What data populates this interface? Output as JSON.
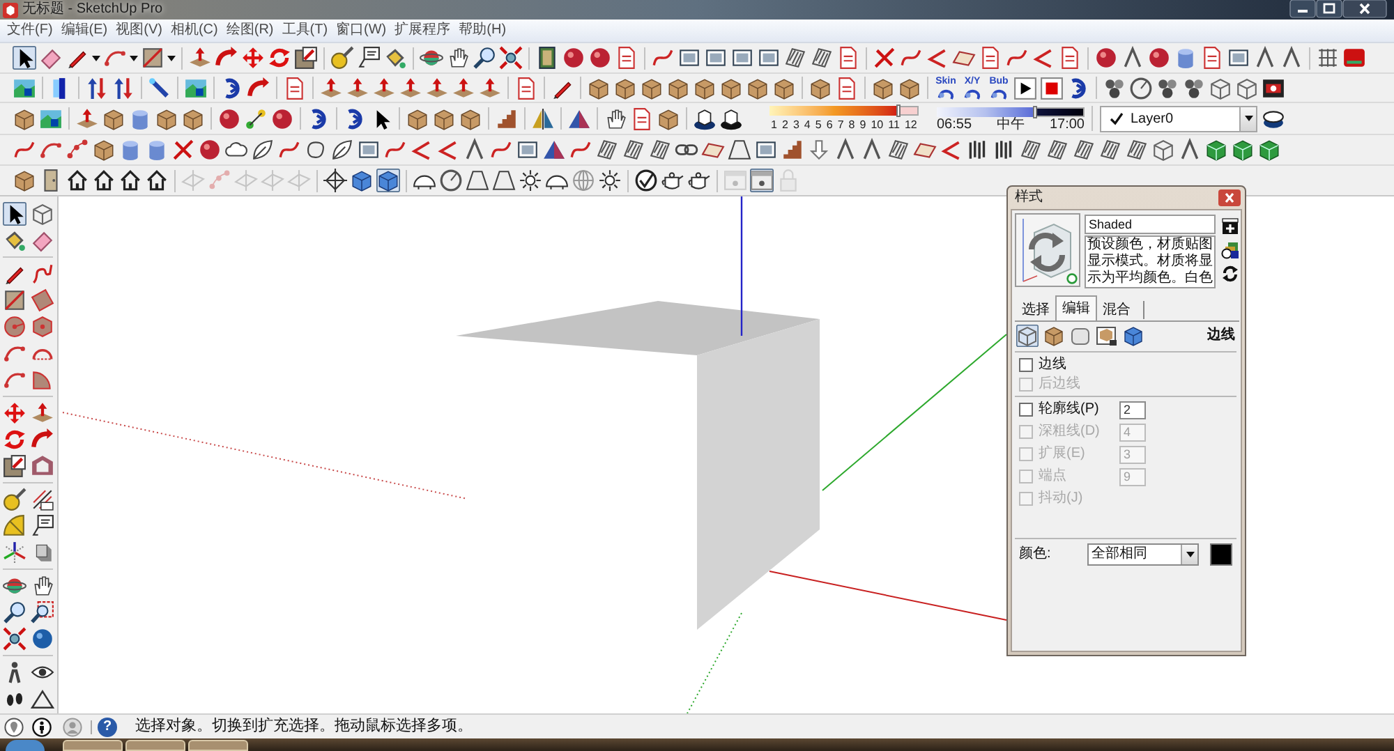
{
  "window": {
    "title": "无标题 - SketchUp Pro"
  },
  "menu": [
    "文件(F)",
    "编辑(E)",
    "视图(V)",
    "相机(C)",
    "绘图(R)",
    "工具(T)",
    "窗口(W)",
    "扩展程序",
    "帮助(H)"
  ],
  "toolbar_rows": [
    {
      "buttons": [
        {
          "selected": true
        },
        {
          "selected": false
        },
        {
          "selected": false
        },
        {
          "selected": false
        },
        {
          "selected": false
        },
        {
          "selected": false
        },
        {
          "selected": false
        },
        {
          "selected": false
        },
        {
          "selected": false
        },
        {
          "selected": false
        },
        {
          "selected": false
        },
        {
          "selected": false
        },
        {
          "selected": false
        },
        {
          "selected": false
        },
        {
          "selected": false
        },
        {
          "selected": false
        },
        {
          "selected": false
        },
        {
          "selected": false
        },
        {
          "selected": false
        },
        {
          "selected": false
        },
        {
          "selected": false
        },
        {
          "selected": false
        },
        {
          "selected": false
        },
        {
          "selected": false
        },
        {
          "selected": false
        },
        {
          "selected": false
        },
        {
          "selected": false
        },
        {
          "selected": false
        },
        {
          "selected": false
        },
        {
          "selected": false
        },
        {
          "selected": false
        },
        {
          "selected": false
        },
        {
          "selected": false
        },
        {
          "selected": false
        },
        {
          "selected": false
        },
        {
          "selected": false
        },
        {
          "selected": false
        },
        {
          "selected": false
        },
        {
          "selected": false
        },
        {
          "selected": false
        },
        {
          "selected": false
        },
        {
          "selected": false
        },
        {
          "selected": false
        },
        {
          "selected": false
        },
        {
          "selected": false
        },
        {
          "selected": false
        },
        {
          "selected": false
        }
      ]
    },
    {
      "buttons": [
        {
          "selected": false
        },
        {
          "selected": false
        },
        {
          "selected": false
        },
        {
          "selected": false
        },
        {
          "selected": false
        },
        {
          "selected": false
        },
        {
          "selected": false
        },
        {
          "selected": false
        },
        {
          "selected": false
        },
        {
          "selected": false
        },
        {
          "selected": false
        },
        {
          "selected": false
        },
        {
          "selected": false
        },
        {
          "selected": false
        },
        {
          "selected": false
        },
        {
          "selected": false
        },
        {
          "selected": false
        },
        {
          "selected": false
        },
        {
          "selected": false
        },
        {
          "selected": false
        },
        {
          "selected": false
        },
        {
          "selected": false
        },
        {
          "selected": false
        },
        {
          "selected": false
        },
        {
          "selected": false
        },
        {
          "selected": false
        },
        {
          "selected": false
        },
        {
          "selected": false
        },
        {
          "selected": false
        },
        {
          "selected": false
        },
        {
          "selected": false,
          "label": "Skin"
        },
        {
          "selected": false,
          "label": "X/Y"
        },
        {
          "selected": false,
          "label": "Bub"
        },
        {
          "selected": false
        },
        {
          "selected": false
        },
        {
          "selected": false
        },
        {
          "selected": false
        },
        {
          "selected": false
        },
        {
          "selected": false
        },
        {
          "selected": false
        },
        {
          "selected": false
        },
        {
          "selected": false
        },
        {
          "selected": false
        }
      ]
    },
    {
      "buttons": [
        {
          "selected": false
        },
        {
          "selected": false
        },
        {
          "selected": false
        },
        {
          "selected": false
        },
        {
          "selected": false
        },
        {
          "selected": false
        },
        {
          "selected": false
        },
        {
          "selected": false
        },
        {
          "selected": false
        },
        {
          "selected": false
        },
        {
          "selected": false
        },
        {
          "selected": false
        },
        {
          "selected": false
        },
        {
          "selected": false
        },
        {
          "selected": false
        },
        {
          "selected": false
        },
        {
          "selected": false
        },
        {
          "selected": false
        },
        {
          "selected": false
        },
        {
          "selected": false
        },
        {
          "selected": false
        },
        {
          "selected": false
        },
        {
          "selected": false
        },
        {
          "selected": false
        }
      ],
      "month_slider": {
        "level": 0.86,
        "ticks": [
          "1",
          "2",
          "3",
          "4",
          "5",
          "6",
          "7",
          "8",
          "9",
          "10",
          "11",
          "12"
        ]
      },
      "time_slider": {
        "level": 0.66,
        "labels": [
          "06:55",
          "中午",
          "17:00"
        ]
      },
      "layer": {
        "name": "Layer0",
        "checked": true
      },
      "layer_buttons": [
        {
          "selected": false
        }
      ]
    },
    {
      "buttons": [
        {
          "selected": false
        },
        {
          "selected": false
        },
        {
          "selected": false
        },
        {
          "selected": false
        },
        {
          "selected": false
        },
        {
          "selected": false
        },
        {
          "selected": false
        },
        {
          "selected": false
        },
        {
          "selected": false
        },
        {
          "selected": false
        },
        {
          "selected": false
        },
        {
          "selected": false
        },
        {
          "selected": false
        },
        {
          "selected": false
        },
        {
          "selected": false
        },
        {
          "selected": false
        },
        {
          "selected": false
        },
        {
          "selected": false
        },
        {
          "selected": false
        },
        {
          "selected": false
        },
        {
          "selected": false
        },
        {
          "selected": false
        },
        {
          "selected": false
        },
        {
          "selected": false
        },
        {
          "selected": false
        },
        {
          "selected": false
        },
        {
          "selected": false
        },
        {
          "selected": false
        },
        {
          "selected": false
        },
        {
          "selected": false
        },
        {
          "selected": false
        },
        {
          "selected": false
        },
        {
          "selected": false
        },
        {
          "selected": false
        },
        {
          "selected": false
        },
        {
          "selected": false
        },
        {
          "selected": false
        },
        {
          "selected": false
        },
        {
          "selected": false
        },
        {
          "selected": false
        },
        {
          "selected": false
        },
        {
          "selected": false
        },
        {
          "selected": false
        },
        {
          "selected": false
        },
        {
          "selected": false
        },
        {
          "selected": false
        },
        {
          "selected": false
        },
        {
          "selected": false
        }
      ]
    },
    {
      "buttons": [
        {
          "selected": false,
          "disabled": false
        },
        {
          "selected": false,
          "disabled": false
        },
        {
          "selected": false,
          "disabled": false
        },
        {
          "selected": false,
          "disabled": false
        },
        {
          "selected": false,
          "disabled": false
        },
        {
          "selected": false,
          "disabled": false
        },
        {
          "selected": false,
          "disabled": true
        },
        {
          "selected": false,
          "disabled": true
        },
        {
          "selected": false,
          "disabled": true
        },
        {
          "selected": false,
          "disabled": true
        },
        {
          "selected": false,
          "disabled": true
        },
        {
          "selected": false,
          "disabled": false
        },
        {
          "selected": false,
          "disabled": false
        },
        {
          "selected": true,
          "disabled": false
        },
        {
          "selected": false,
          "disabled": false
        },
        {
          "selected": false,
          "disabled": false
        },
        {
          "selected": false,
          "disabled": false
        },
        {
          "selected": false,
          "disabled": false
        },
        {
          "selected": false,
          "disabled": false
        },
        {
          "selected": false,
          "disabled": false
        },
        {
          "selected": false,
          "disabled": false
        },
        {
          "selected": false,
          "disabled": false
        },
        {
          "selected": false,
          "disabled": false
        },
        {
          "selected": false,
          "disabled": false
        },
        {
          "selected": false,
          "disabled": false
        },
        {
          "selected": false,
          "disabled": true
        },
        {
          "selected": true,
          "disabled": false
        },
        {
          "selected": false,
          "disabled": true
        }
      ]
    }
  ],
  "left_toolbar": {
    "buttons": [
      {
        "selected": true
      },
      {
        "selected": false
      },
      {
        "selected": false
      },
      {
        "selected": false
      },
      {
        "selected": false
      },
      {
        "selected": false
      },
      {
        "selected": false
      },
      {
        "selected": false
      },
      {
        "selected": false
      },
      {
        "selected": false
      },
      {
        "selected": false
      },
      {
        "selected": false
      },
      {
        "selected": false
      },
      {
        "selected": false
      },
      {
        "selected": false
      },
      {
        "selected": false
      },
      {
        "selected": false
      },
      {
        "selected": false
      },
      {
        "selected": false
      },
      {
        "selected": false
      },
      {
        "selected": false
      },
      {
        "selected": false
      },
      {
        "selected": false
      },
      {
        "selected": false
      },
      {
        "selected": false
      },
      {
        "selected": false
      },
      {
        "selected": false
      },
      {
        "selected": false
      },
      {
        "selected": false
      },
      {
        "selected": false
      },
      {
        "selected": false
      },
      {
        "selected": false
      },
      {
        "selected": false
      },
      {
        "selected": false
      },
      {
        "selected": false
      },
      {
        "selected": false
      }
    ]
  },
  "styles_panel": {
    "title": "样式",
    "style_name": "Shaded",
    "description": "预设颜色，材质贴图显示模式。材质将显示为平均颜色。白色",
    "tabs": [
      {
        "label": "选择",
        "selected": false
      },
      {
        "label": "编辑",
        "selected": true
      },
      {
        "label": "混合",
        "selected": false
      }
    ],
    "edit_modes": [
      {
        "selected": true
      },
      {
        "selected": false
      },
      {
        "selected": false
      },
      {
        "selected": false
      },
      {
        "selected": false
      }
    ],
    "section_title": "边线",
    "edge_options": [
      {
        "label": "边线",
        "checked": false,
        "disabled": false
      },
      {
        "label": "后边线",
        "checked": false,
        "disabled": true
      }
    ],
    "line_options": [
      {
        "label": "轮廓线(P)",
        "checked": false,
        "disabled": false,
        "value": "2"
      },
      {
        "label": "深粗线(D)",
        "checked": false,
        "disabled": true,
        "value": "4"
      },
      {
        "label": "扩展(E)",
        "checked": false,
        "disabled": true,
        "value": "3"
      },
      {
        "label": "端点",
        "checked": false,
        "disabled": true,
        "value": "9"
      },
      {
        "label": "抖动(J)",
        "checked": false,
        "disabled": true
      }
    ],
    "color_label": "颜色:",
    "color_mode": "全部相同",
    "edge_swatch": {
      "color": "#000000"
    }
  },
  "status_bar": {
    "help_glyph": "?",
    "message": "选择对象。切换到扩充选择。拖动鼠标选择多项。"
  }
}
